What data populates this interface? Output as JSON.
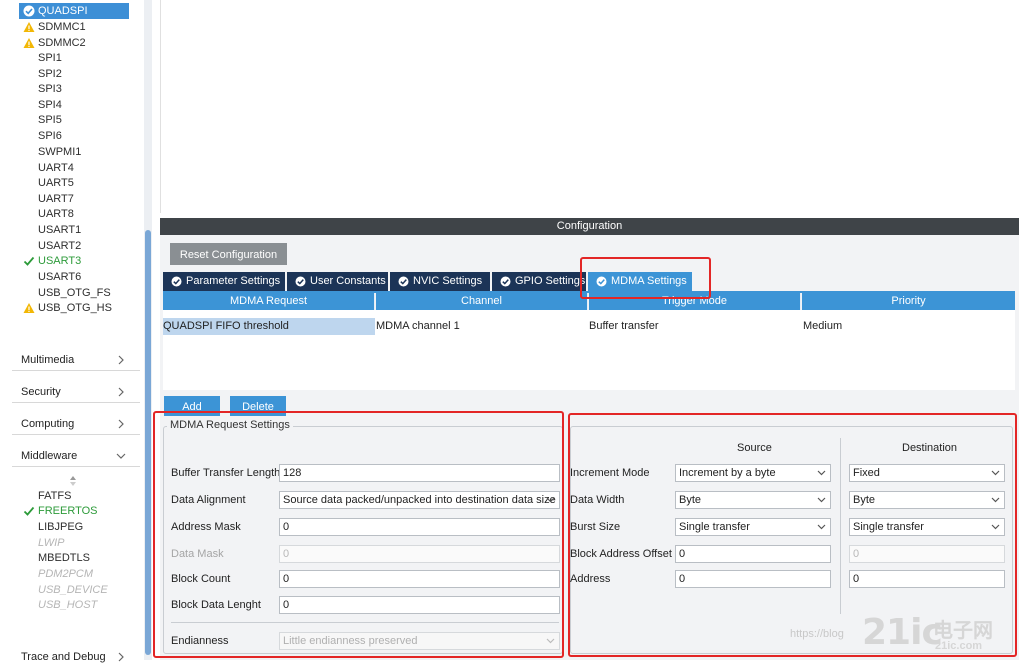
{
  "sidebar": {
    "peripherals": [
      {
        "label": "QUADSPI",
        "status": "ok",
        "selected": true
      },
      {
        "label": "SDMMC1",
        "status": "warn"
      },
      {
        "label": "SDMMC2",
        "status": "warn"
      },
      {
        "label": "SPI1",
        "status": "none"
      },
      {
        "label": "SPI2",
        "status": "none"
      },
      {
        "label": "SPI3",
        "status": "none"
      },
      {
        "label": "SPI4",
        "status": "none"
      },
      {
        "label": "SPI5",
        "status": "none"
      },
      {
        "label": "SPI6",
        "status": "none"
      },
      {
        "label": "SWPMI1",
        "status": "none"
      },
      {
        "label": "UART4",
        "status": "none"
      },
      {
        "label": "UART5",
        "status": "none"
      },
      {
        "label": "UART7",
        "status": "none"
      },
      {
        "label": "UART8",
        "status": "none"
      },
      {
        "label": "USART1",
        "status": "none"
      },
      {
        "label": "USART2",
        "status": "none"
      },
      {
        "label": "USART3",
        "status": "check"
      },
      {
        "label": "USART6",
        "status": "none"
      },
      {
        "label": "USB_OTG_FS",
        "status": "none"
      },
      {
        "label": "USB_OTG_HS",
        "status": "warn"
      }
    ],
    "categories": [
      {
        "label": "Multimedia",
        "chevron": "right"
      },
      {
        "label": "Security",
        "chevron": "right"
      },
      {
        "label": "Computing",
        "chevron": "right"
      },
      {
        "label": "Middleware",
        "chevron": "down"
      }
    ],
    "middleware": [
      {
        "label": "FATFS",
        "status": "none"
      },
      {
        "label": "FREERTOS",
        "status": "check"
      },
      {
        "label": "LIBJPEG",
        "status": "none"
      },
      {
        "label": "LWIP",
        "status": "disabled"
      },
      {
        "label": "MBEDTLS",
        "status": "none"
      },
      {
        "label": "PDM2PCM",
        "status": "disabled"
      },
      {
        "label": "USB_DEVICE",
        "status": "disabled"
      },
      {
        "label": "USB_HOST",
        "status": "disabled"
      }
    ],
    "bottom_category": {
      "label": "Trace and Debug",
      "chevron": "right"
    }
  },
  "config_bar": {
    "title": "Configuration"
  },
  "reset_button": "Reset Configuration",
  "tabs": [
    {
      "label": "Parameter Settings",
      "active": false
    },
    {
      "label": "User Constants",
      "active": false
    },
    {
      "label": "NVIC Settings",
      "active": false
    },
    {
      "label": "GPIO Settings",
      "active": false
    },
    {
      "label": "MDMA Settings",
      "active": true
    }
  ],
  "mdma_table": {
    "headers": [
      "MDMA Request",
      "Channel",
      "Trigger Mode",
      "Priority"
    ],
    "rows": [
      [
        "QUADSPI FIFO threshold",
        "MDMA channel 1",
        "Buffer transfer",
        "Medium"
      ]
    ]
  },
  "buttons": {
    "add": "Add",
    "delete": "Delete"
  },
  "request_settings": {
    "title": "MDMA Request Settings",
    "buffer_transfer_length": {
      "label": "Buffer Transfer Length",
      "value": "128"
    },
    "data_alignment": {
      "label": "Data Alignment",
      "value": "Source data packed/unpacked into destination data size"
    },
    "address_mask": {
      "label": "Address Mask",
      "value": "0"
    },
    "data_mask": {
      "label": "Data Mask",
      "value": "0"
    },
    "block_count": {
      "label": "Block Count",
      "value": "0"
    },
    "block_data_length": {
      "label": "Block Data Lenght",
      "value": "0"
    },
    "endianness": {
      "label": "Endianness",
      "value": "Little endianness preserved"
    }
  },
  "source_dest": {
    "source_header": "Source",
    "destination_header": "Destination",
    "rows": [
      {
        "label": "Increment Mode",
        "source": "Increment by a byte",
        "destination": "Fixed",
        "type": "combo"
      },
      {
        "label": "Data Width",
        "source": "Byte",
        "destination": "Byte",
        "type": "combo"
      },
      {
        "label": "Burst Size",
        "source": "Single transfer",
        "destination": "Single transfer",
        "type": "combo"
      },
      {
        "label": "Block Address Offset",
        "source": "0",
        "destination": "0",
        "type": "field",
        "dest_disabled": true
      },
      {
        "label": "Address",
        "source": "0",
        "destination": "0",
        "type": "field"
      }
    ]
  },
  "watermark": {
    "blog": "https://blog",
    "logo": "21ic",
    "cn": "电子网",
    "url": "21ic.com"
  },
  "colors": {
    "accent": "#3c94d6",
    "tab_dark": "#1c3457",
    "highlight": "#e32626",
    "ok": "#2d9b3a",
    "warn": "#f2b705"
  }
}
